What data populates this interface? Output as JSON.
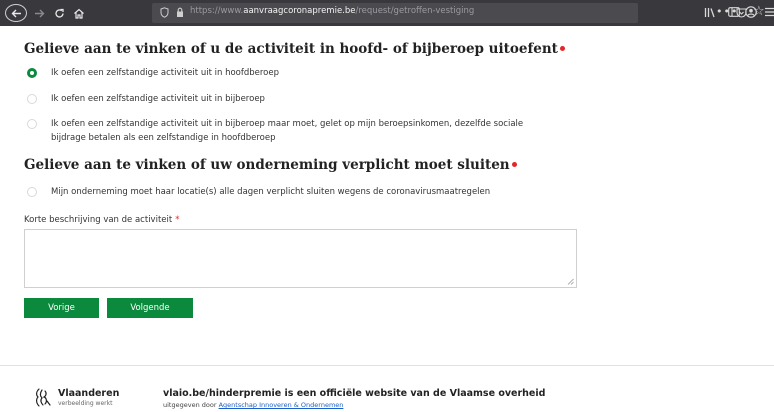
{
  "browser": {
    "url_prefix": "https://www.",
    "url_domain": "aanvraagcoronapremie.be",
    "url_path": "/request/getroffen-vestiging"
  },
  "form": {
    "question1": {
      "title": "Gelieve aan te vinken of u de activiteit in hoofd- of bijberoep uitoefent",
      "options": [
        {
          "label": "Ik oefen een zelfstandige activiteit uit in hoofdberoep",
          "selected": true
        },
        {
          "label": "Ik oefen een zelfstandige activiteit uit in bijberoep",
          "selected": false
        },
        {
          "label": "Ik oefen een zelfstandige activiteit uit in bijberoep maar moet, gelet op mijn beroepsinkomen, dezelfde sociale",
          "label_line2": "bijdrage betalen als een zelfstandige in hoofdberoep",
          "selected": false
        }
      ]
    },
    "question2": {
      "title": "Gelieve aan te vinken of uw onderneming verplicht moet sluiten",
      "options": [
        {
          "label": "Mijn onderneming moet haar locatie(s) alle dagen verplicht sluiten wegens de coronavirusmaatregelen",
          "selected": false
        }
      ]
    },
    "description": {
      "label": "Korte beschrijving van de activiteit",
      "required_marker": "*",
      "value": ""
    },
    "buttons": {
      "previous": "Vorige",
      "next": "Volgende"
    }
  },
  "footer": {
    "logo_name": "Vlaanderen",
    "logo_tagline": "verbeelding werkt",
    "title": "vlaio.be/hinderpremie is een officiële website van de Vlaamse overheid",
    "subtitle_prefix": "uitgegeven door ",
    "subtitle_link": "Agentschap Innoveren & Ondernemen"
  },
  "colors": {
    "accent_green": "#0b8a3e",
    "required_red": "#e3262a",
    "toolbar_bg": "#38383d"
  }
}
